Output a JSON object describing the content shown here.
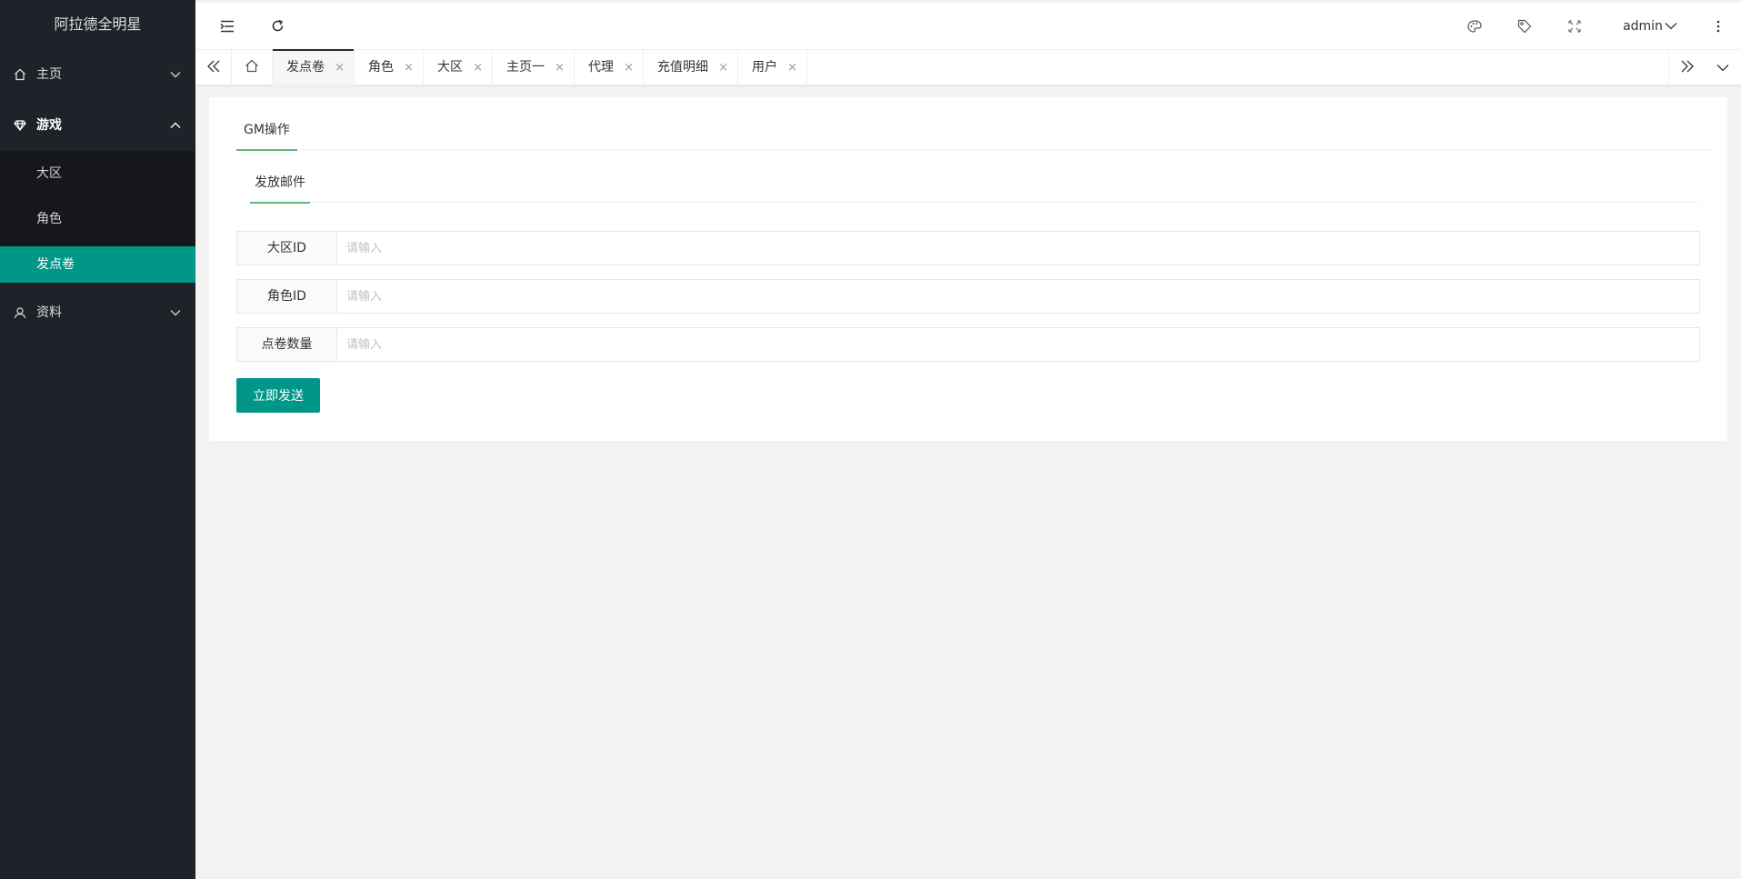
{
  "app": {
    "title": "阿拉德全明星"
  },
  "sidebar": {
    "items": [
      {
        "label": "主页",
        "icon": "home-icon",
        "state": "collapsed"
      },
      {
        "label": "游戏",
        "icon": "diamond-icon",
        "state": "expanded",
        "children": [
          {
            "label": "大区"
          },
          {
            "label": "角色"
          },
          {
            "label": "发点卷",
            "active": true
          }
        ]
      },
      {
        "label": "资料",
        "icon": "user-icon",
        "state": "collapsed"
      }
    ]
  },
  "header": {
    "user": "admin",
    "icons": [
      "menu-fold-icon",
      "refresh-icon",
      "theme-palette-icon",
      "tag-icon",
      "fullscreen-icon",
      "more-icon"
    ]
  },
  "tabs": {
    "items": [
      {
        "label": "发点卷",
        "active": true
      },
      {
        "label": "角色"
      },
      {
        "label": "大区"
      },
      {
        "label": "主页一"
      },
      {
        "label": "代理"
      },
      {
        "label": "充值明细"
      },
      {
        "label": "用户"
      }
    ],
    "close_glyph": "×"
  },
  "content": {
    "outer_tab": "GM操作",
    "inner_tab": "发放邮件",
    "form": {
      "fields": [
        {
          "label": "大区ID",
          "placeholder": "请输入",
          "value": ""
        },
        {
          "label": "角色ID",
          "placeholder": "请输入",
          "value": ""
        },
        {
          "label": "点卷数量",
          "placeholder": "请输入",
          "value": ""
        }
      ],
      "submit_label": "立即发送"
    }
  },
  "colors": {
    "sidebar_bg": "#20222a",
    "accent": "#009688",
    "tab_underline": "#5fb878"
  }
}
